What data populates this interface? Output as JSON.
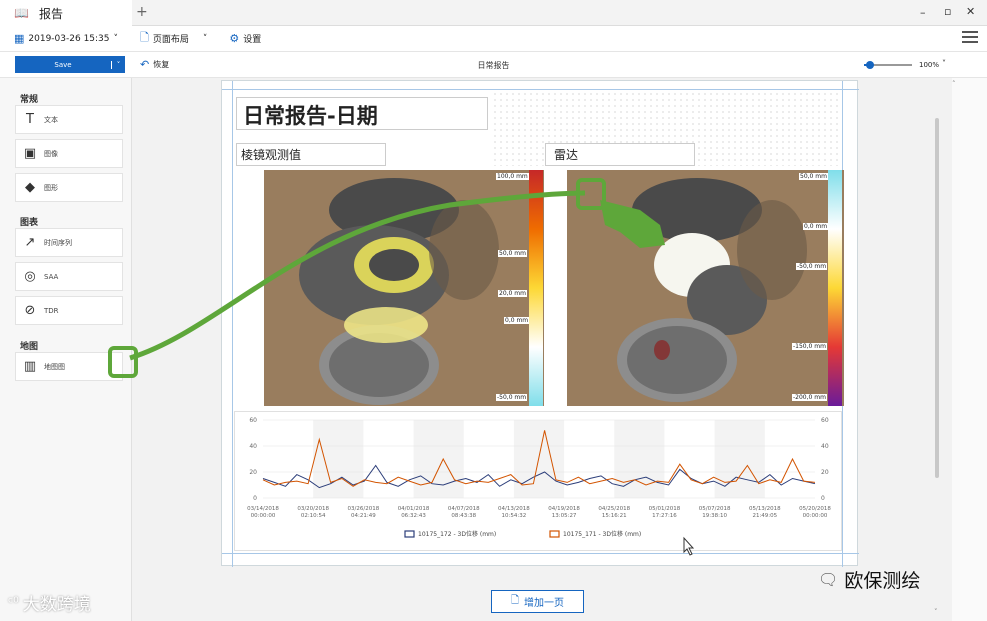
{
  "window": {
    "tab_title": "报告",
    "new_tab": "+",
    "controls": [
      "–",
      "▫",
      "✕"
    ]
  },
  "toolbar": {
    "date": "2019-03-26 15:35",
    "layout_label": "页面布局",
    "settings_label": "设置"
  },
  "subbar": {
    "save_label": "Save",
    "undo_label": "恢复",
    "doc_title": "日常报告",
    "zoom_value": "100%",
    "zoom_fraction": 0.12
  },
  "sidebar": {
    "sections": [
      {
        "title": "常规",
        "items": [
          {
            "label": "文本",
            "icon": "text-icon"
          },
          {
            "label": "图像",
            "icon": "image-icon"
          },
          {
            "label": "图形",
            "icon": "shapes-icon"
          }
        ]
      },
      {
        "title": "图表",
        "items": [
          {
            "label": "时间序列",
            "icon": "line-chart-icon"
          },
          {
            "label": "SAA",
            "icon": "saa-icon"
          },
          {
            "label": "TDR",
            "icon": "tdr-icon"
          }
        ]
      },
      {
        "title": "地图",
        "items": [
          {
            "label": "地图图",
            "icon": "map-icon"
          }
        ]
      }
    ]
  },
  "report": {
    "title": "日常报告-日期",
    "left_panel": {
      "title": "棱镜观测值",
      "scale": [
        "100,0 mm",
        "50,0 mm",
        "20,0 mm",
        "0,0 mm",
        "-50,0 mm"
      ],
      "colors": [
        "#c62828",
        "#ef6c00",
        "#fdd835",
        "#ffffff",
        "#80deea"
      ]
    },
    "right_panel": {
      "title": "雷达",
      "scale": [
        "50,0 mm",
        "0,0 mm",
        "-50,0 mm",
        "-150,0 mm",
        "-200,0 mm"
      ],
      "colors": [
        "#80deea",
        "#ffffff",
        "#fdd835",
        "#e53935",
        "#6a1b9a"
      ]
    },
    "add_page_label": "增加一页"
  },
  "chart_data": {
    "type": "line",
    "ylim": [
      0,
      60
    ],
    "y_ticks": [
      0,
      20,
      40,
      60
    ],
    "x_ticks": [
      {
        "date": "03/14/2018",
        "time": "00:00:00"
      },
      {
        "date": "03/20/2018",
        "time": "02:10:54"
      },
      {
        "date": "03/26/2018",
        "time": "04:21:49"
      },
      {
        "date": "04/01/2018",
        "time": "06:32:43"
      },
      {
        "date": "04/07/2018",
        "time": "08:43:38"
      },
      {
        "date": "04/13/2018",
        "time": "10:54:32"
      },
      {
        "date": "04/19/2018",
        "time": "13:05:27"
      },
      {
        "date": "04/25/2018",
        "time": "15:16:21"
      },
      {
        "date": "05/01/2018",
        "time": "17:27:16"
      },
      {
        "date": "05/07/2018",
        "time": "19:38:10"
      },
      {
        "date": "05/13/2018",
        "time": "21:49:05"
      },
      {
        "date": "05/20/2018",
        "time": "00:00:00"
      }
    ],
    "series": [
      {
        "name": "10175_172 - 3D位移 (mm)",
        "color": "#2c3e7a",
        "values": [
          15,
          12,
          9,
          18,
          14,
          8,
          11,
          16,
          10,
          13,
          25,
          12,
          9,
          14,
          17,
          11,
          10,
          13,
          15,
          12,
          18,
          9,
          14,
          11,
          16,
          20,
          13,
          10,
          12,
          15,
          17,
          11,
          9,
          14,
          16,
          12,
          10,
          22,
          15,
          11,
          13,
          9,
          16,
          14,
          12,
          18,
          10,
          15,
          13,
          11
        ]
      },
      {
        "name": "10175_171 - 3D位移 (mm)",
        "color": "#d35400",
        "values": [
          14,
          10,
          12,
          13,
          11,
          45,
          12,
          15,
          9,
          14,
          12,
          11,
          16,
          13,
          10,
          12,
          30,
          14,
          11,
          13,
          12,
          15,
          18,
          10,
          11,
          52,
          14,
          12,
          16,
          11,
          13,
          15,
          12,
          14,
          10,
          13,
          12,
          26,
          14,
          11,
          16,
          12,
          13,
          25,
          11,
          14,
          12,
          30,
          13,
          12
        ]
      }
    ]
  },
  "watermarks": {
    "left": "大数跨境",
    "right": "欧保测绘"
  }
}
